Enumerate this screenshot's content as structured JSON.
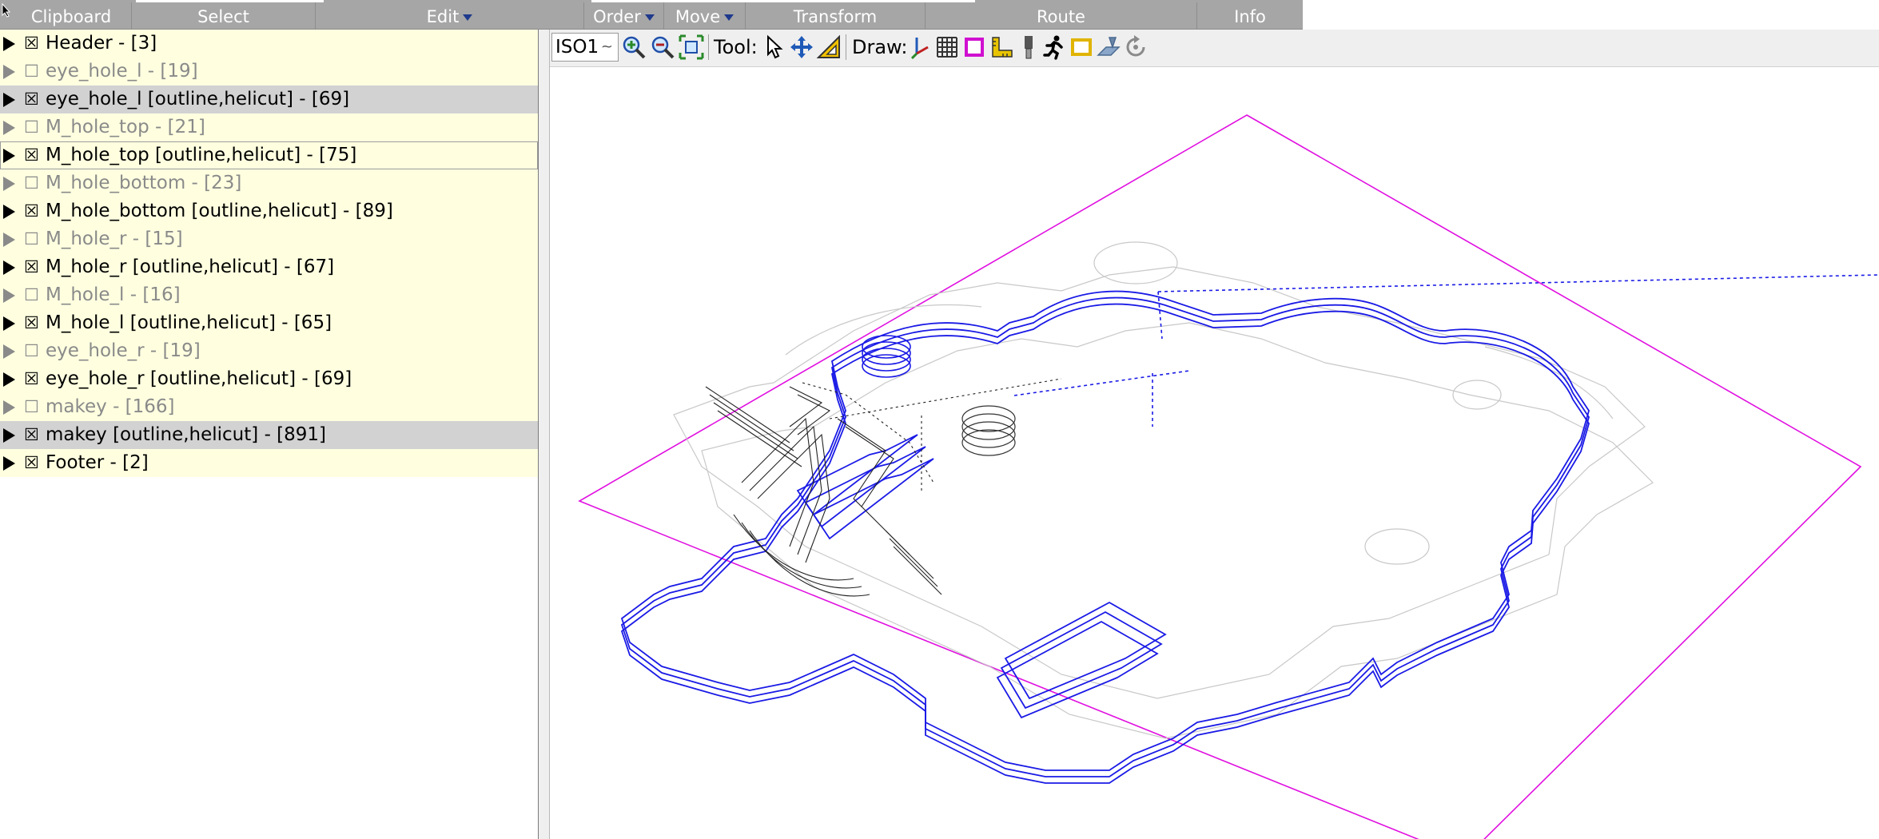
{
  "menu": {
    "clipboard": "Clipboard",
    "select": "Select",
    "edit": "Edit",
    "order": "Order",
    "move": "Move",
    "transform": "Transform",
    "route": "Route",
    "info": "Info"
  },
  "layers": [
    {
      "label": "Header - [3]",
      "checkbox": "☒",
      "enabled": true,
      "selected": false
    },
    {
      "label": "eye_hole_l - [19]",
      "checkbox": "☐",
      "enabled": false,
      "selected": false
    },
    {
      "label": "eye_hole_l [outline,helicut] - [69]",
      "checkbox": "☒",
      "enabled": true,
      "selected": true
    },
    {
      "label": "M_hole_top - [21]",
      "checkbox": "☐",
      "enabled": false,
      "selected": false
    },
    {
      "label": "M_hole_top [outline,helicut] - [75]",
      "checkbox": "☒",
      "enabled": true,
      "selected": false,
      "focused": true
    },
    {
      "label": "M_hole_bottom - [23]",
      "checkbox": "☐",
      "enabled": false,
      "selected": false
    },
    {
      "label": "M_hole_bottom [outline,helicut] - [89]",
      "checkbox": "☒",
      "enabled": true,
      "selected": false
    },
    {
      "label": "M_hole_r - [15]",
      "checkbox": "☐",
      "enabled": false,
      "selected": false
    },
    {
      "label": "M_hole_r [outline,helicut] - [67]",
      "checkbox": "☒",
      "enabled": true,
      "selected": false
    },
    {
      "label": "M_hole_l - [16]",
      "checkbox": "☐",
      "enabled": false,
      "selected": false
    },
    {
      "label": "M_hole_l [outline,helicut] - [65]",
      "checkbox": "☒",
      "enabled": true,
      "selected": false
    },
    {
      "label": "eye_hole_r - [19]",
      "checkbox": "☐",
      "enabled": false,
      "selected": false
    },
    {
      "label": "eye_hole_r [outline,helicut] - [69]",
      "checkbox": "☒",
      "enabled": true,
      "selected": false
    },
    {
      "label": "makey - [166]",
      "checkbox": "☐",
      "enabled": false,
      "selected": false
    },
    {
      "label": "makey [outline,helicut] - [891]",
      "checkbox": "☒",
      "enabled": true,
      "selected": true
    },
    {
      "label": "Footer - [2]",
      "checkbox": "☒",
      "enabled": true,
      "selected": false
    }
  ],
  "toolbar": {
    "view_value": "ISO1",
    "view_dropdown_glyph": "~",
    "tool_label": "Tool:",
    "draw_label": "Draw:"
  },
  "icons": {
    "zoom_in": "zoom-in-icon",
    "zoom_out": "zoom-out-icon",
    "zoom_fit": "zoom-fit-icon",
    "select_tool": "pointer-arrow-icon",
    "move_tool": "move-arrows-icon",
    "measure_tool": "set-square-icon",
    "axes": "axes-icon",
    "grid": "grid-icon",
    "bounding_box": "magenta-box-icon",
    "ruler": "ruler-icon",
    "tool_bit": "tool-bit-icon",
    "runner": "running-man-icon",
    "workpiece": "yellow-frame-icon",
    "machine": "machine-icon",
    "rotate": "rotate-icon"
  },
  "colors": {
    "menubar_bg": "#a6a6a6",
    "layer_row_bg": "#ffffe0",
    "layer_selected_bg": "#d2d2d2",
    "toolpath": "#1a1ae6",
    "bounding_box": "#e010e0",
    "outline": "#c8c8c8",
    "rapid": "#1a1ae6",
    "helix": "#222222"
  }
}
